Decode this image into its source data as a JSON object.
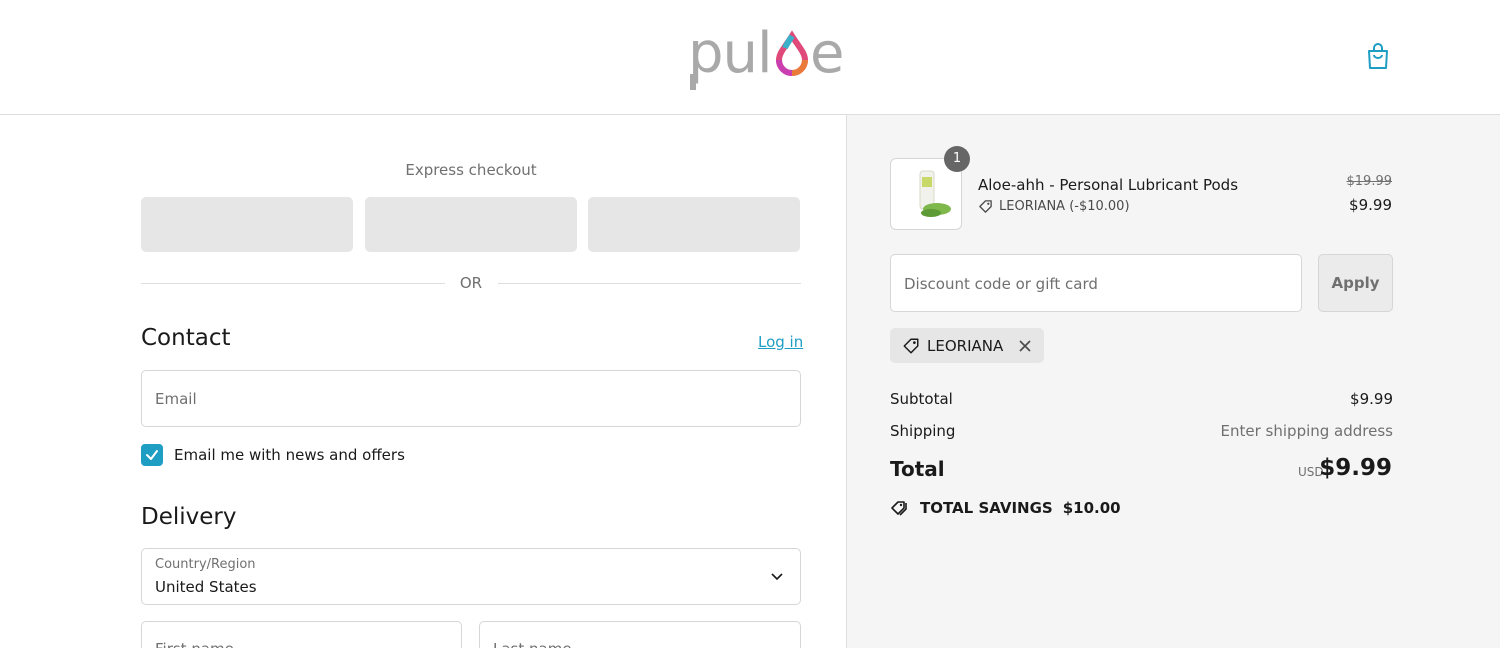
{
  "header": {
    "brand": "pulse"
  },
  "express": {
    "title": "Express checkout",
    "or": "OR"
  },
  "contact": {
    "title": "Contact",
    "login": "Log in",
    "email_placeholder": "Email",
    "newsletter_label": "Email me with news and offers",
    "newsletter_checked": true
  },
  "delivery": {
    "title": "Delivery",
    "country_label": "Country/Region",
    "country_value": "United States",
    "first_placeholder": "First name",
    "last_placeholder": "Last name"
  },
  "summary": {
    "item": {
      "name": "Aloe-ahh - Personal Lubricant Pods",
      "quantity": "1",
      "discount": "LEORIANA (-$10.00)",
      "original_price": "$19.99",
      "price": "$9.99"
    },
    "discount_placeholder": "Discount code or gift card",
    "apply_label": "Apply",
    "applied_code": "LEORIANA",
    "subtotal_label": "Subtotal",
    "subtotal_value": "$9.99",
    "shipping_label": "Shipping",
    "shipping_value": "Enter shipping address",
    "total_label": "Total",
    "currency": "USD",
    "total_value": "$9.99",
    "savings_label": "TOTAL SAVINGS",
    "savings_value": "$10.00"
  },
  "colors": {
    "accent": "#1f9ec4",
    "summary_bg": "#f5f5f5"
  }
}
